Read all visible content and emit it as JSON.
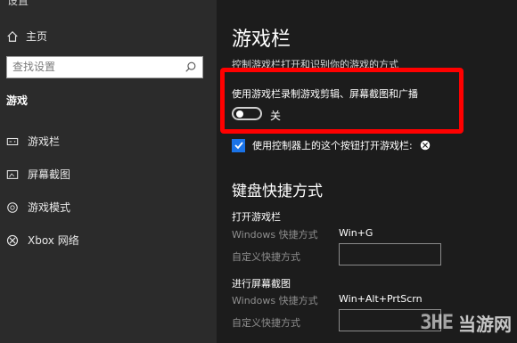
{
  "sidebar": {
    "top_text": "设置",
    "home_label": "主页",
    "search_placeholder": "查找设置",
    "section_title": "游戏",
    "items": [
      {
        "label": "游戏栏",
        "icon": "game-bar-icon"
      },
      {
        "label": "屏幕截图",
        "icon": "screenshot-icon"
      },
      {
        "label": "游戏模式",
        "icon": "game-mode-icon"
      },
      {
        "label": "Xbox 网络",
        "icon": "xbox-icon"
      }
    ]
  },
  "main": {
    "title": "游戏栏",
    "subtitle": "控制游戏栏打开和识别你的游戏的方式",
    "toggle_description": "使用游戏栏录制游戏剪辑、屏幕截图和广播",
    "toggle_state": "关",
    "checkbox_label": "使用控制器上的这个按钮打开游戏栏:",
    "shortcuts_title": "键盘快捷方式",
    "groups": [
      {
        "title": "打开游戏栏",
        "windows_label": "Windows 快捷方式",
        "windows_value": "Win+G",
        "custom_label": "自定义快捷方式"
      },
      {
        "title": "进行屏幕截图",
        "windows_label": "Windows 快捷方式",
        "windows_value": "Win+Alt+PrtScrn",
        "custom_label": "自定义快捷方式"
      }
    ]
  },
  "watermark": {
    "logo": "3HE",
    "text": "当游网"
  },
  "colors": {
    "accent": "#1a73e8",
    "highlight": "#ff0000"
  }
}
